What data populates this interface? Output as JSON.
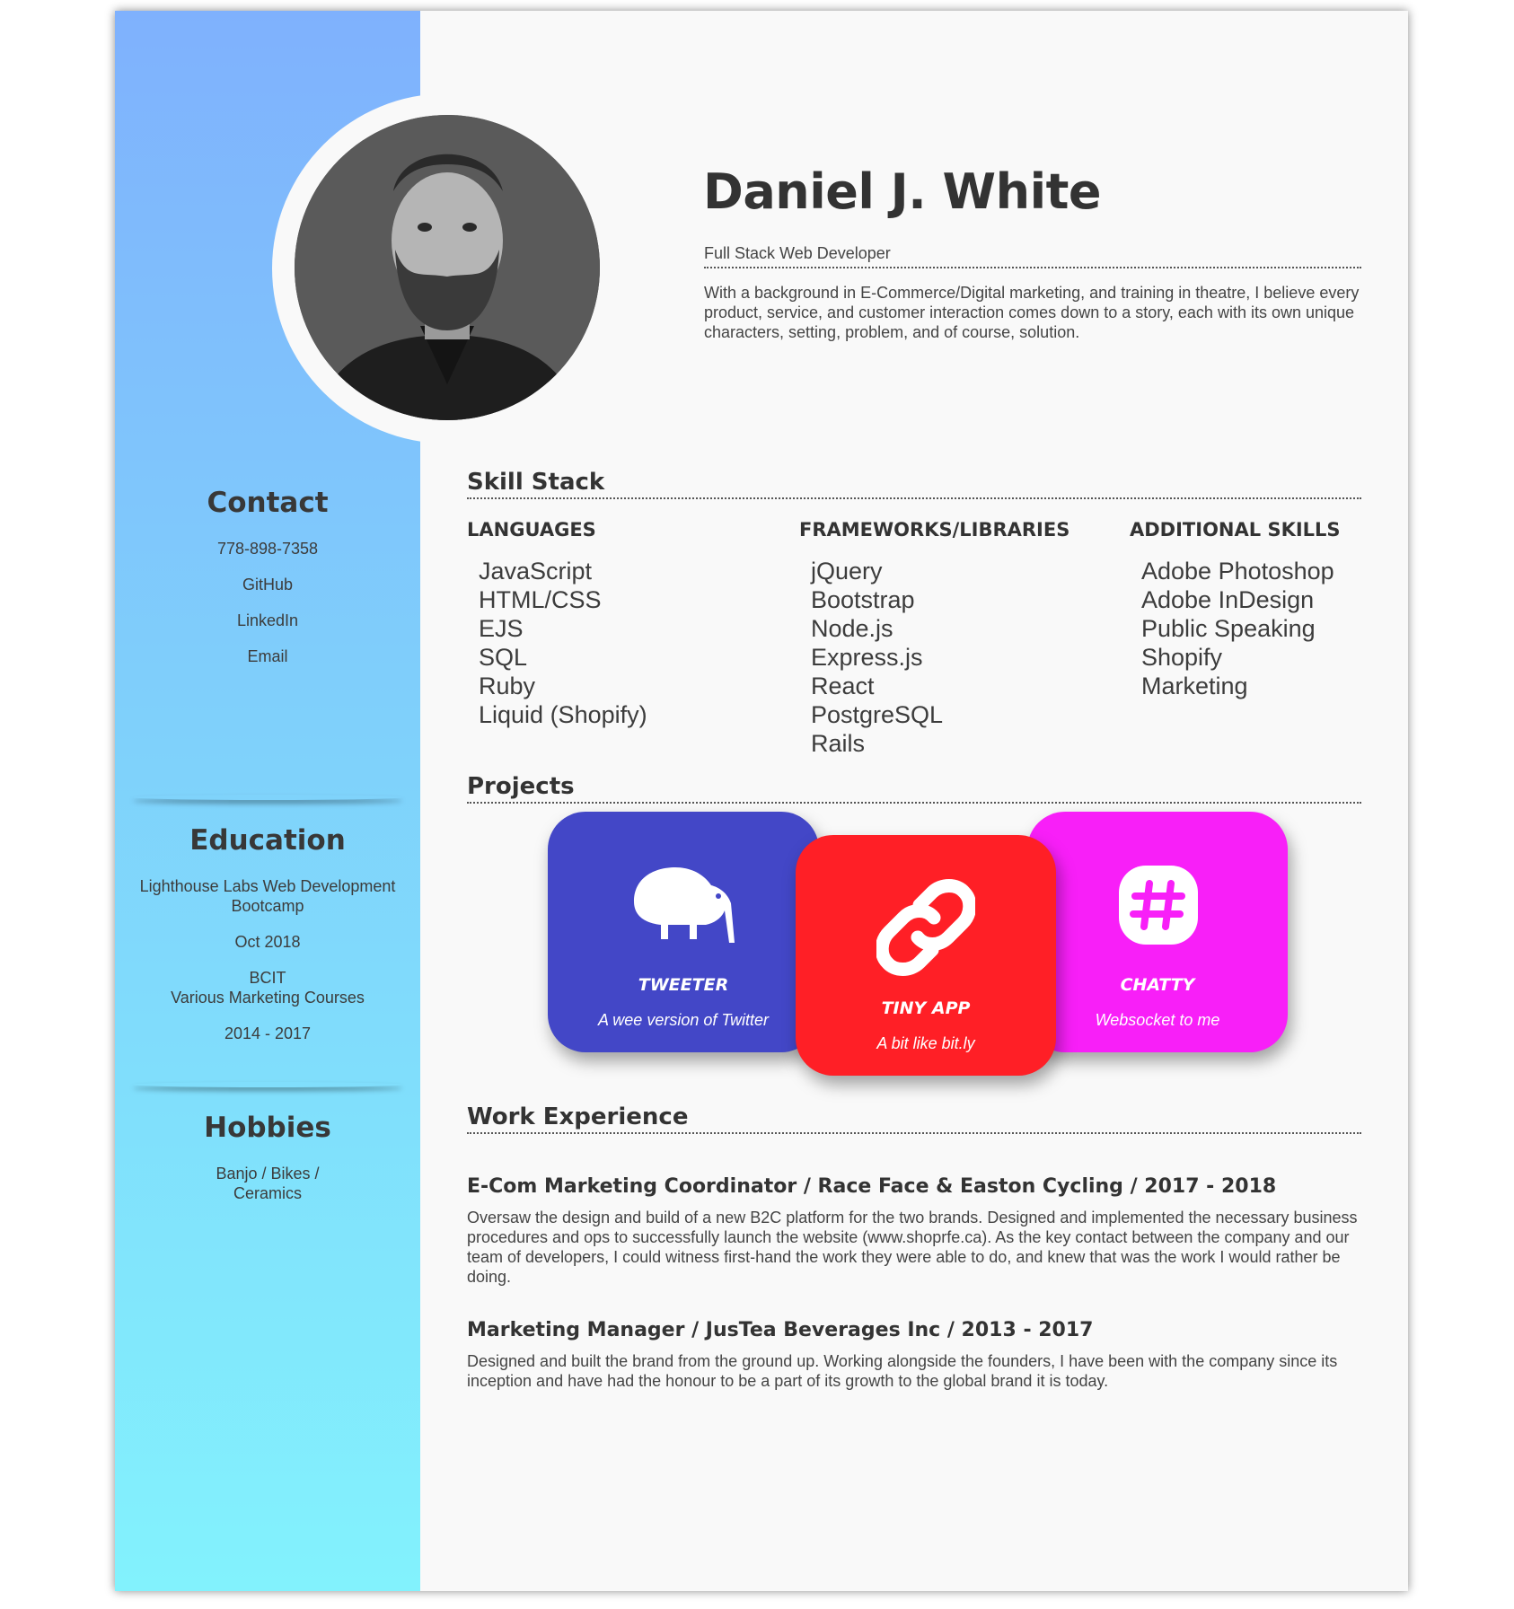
{
  "header": {
    "name": "Daniel J. White",
    "role": "Full Stack Web Developer",
    "intro": "With a background in E-Commerce/Digital marketing, and training in theatre, I believe every product, service, and customer interaction comes down to a story, each with its own unique characters, setting, problem, and of course, solution."
  },
  "sidebar": {
    "contact": {
      "title": "Contact",
      "items": [
        "778-898-7358",
        "GitHub",
        "LinkedIn",
        "Email"
      ]
    },
    "education": {
      "title": "Education",
      "items": [
        "Lighthouse Labs Web Development Bootcamp",
        "Oct 2018",
        "BCIT\nVarious Marketing Courses",
        "2014 - 2017"
      ]
    },
    "hobbies": {
      "title": "Hobbies",
      "items": [
        "Banjo / Bikes / Ceramics"
      ]
    }
  },
  "skills": {
    "title": "Skill Stack",
    "columns": [
      {
        "heading": "LANGUAGES",
        "items": [
          "JavaScript",
          "HTML/CSS",
          "EJS",
          "SQL",
          "Ruby",
          "Liquid (Shopify)"
        ]
      },
      {
        "heading": "FRAMEWORKS/LIBRARIES",
        "items": [
          "jQuery",
          "Bootstrap",
          "Node.js",
          "Express.js",
          "React",
          "PostgreSQL",
          "Rails"
        ]
      },
      {
        "heading": "ADDITIONAL SKILLS",
        "items": [
          "Adobe Photoshop",
          "Adobe InDesign",
          "Public Speaking",
          "Shopify",
          "Marketing"
        ]
      }
    ]
  },
  "projects": {
    "title": "Projects",
    "cards": [
      {
        "title": "TWEETER",
        "subtitle": "A wee version of Twitter",
        "icon": "kiwi-bird-icon",
        "color": "#4347c7"
      },
      {
        "title": "TINY APP",
        "subtitle": "A bit like bit.ly",
        "icon": "link-icon",
        "color": "#ff1f26"
      },
      {
        "title": "CHATTY",
        "subtitle": "Websocket to me",
        "icon": "slack-hash-icon",
        "color": "#f81ff8"
      }
    ]
  },
  "work": {
    "title": "Work Experience",
    "jobs": [
      {
        "title": "E-Com Marketing Coordinator / Race Face & Easton Cycling / 2017 - 2018",
        "description": "Oversaw the design and build of a new B2C platform for the two brands. Designed and implemented the necessary business procedures and ops to successfully launch the website (www.shoprfe.ca). As the key contact between the company and our team of developers, I could witness first-hand the work they were able to do, and knew that was the work I would rather be doing."
      },
      {
        "title": "Marketing Manager / JusTea Beverages Inc / 2013 - 2017",
        "description": "Designed and built the brand from the ground up. Working alongside the founders, I have been with the company since its inception and have had the honour to be a part of its growth to the global brand it is today."
      }
    ]
  }
}
